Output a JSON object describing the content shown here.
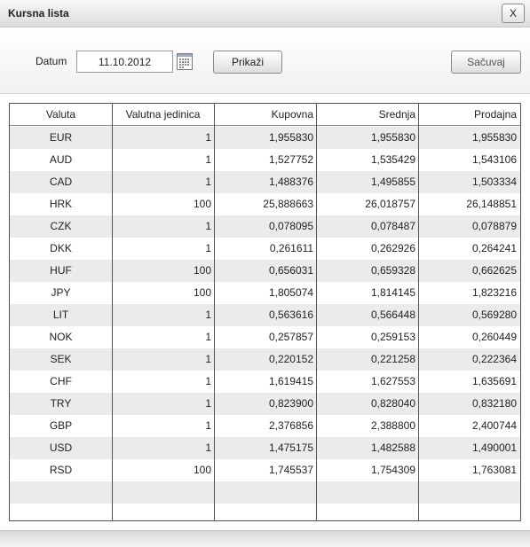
{
  "window": {
    "title": "Kursna lista",
    "close_label": "X"
  },
  "toolbar": {
    "date_label": "Datum",
    "date_value": "11.10.2012",
    "show_label": "Prikaži",
    "save_label": "Sačuvaj"
  },
  "table": {
    "columns": [
      "Valuta",
      "Valutna jedinica",
      "Kupovna",
      "Srednja",
      "Prodajna"
    ],
    "rows": [
      [
        "EUR",
        "1",
        "1,955830",
        "1,955830",
        "1,955830"
      ],
      [
        "AUD",
        "1",
        "1,527752",
        "1,535429",
        "1,543106"
      ],
      [
        "CAD",
        "1",
        "1,488376",
        "1,495855",
        "1,503334"
      ],
      [
        "HRK",
        "100",
        "25,888663",
        "26,018757",
        "26,148851"
      ],
      [
        "CZK",
        "1",
        "0,078095",
        "0,078487",
        "0,078879"
      ],
      [
        "DKK",
        "1",
        "0,261611",
        "0,262926",
        "0,264241"
      ],
      [
        "HUF",
        "100",
        "0,656031",
        "0,659328",
        "0,662625"
      ],
      [
        "JPY",
        "100",
        "1,805074",
        "1,814145",
        "1,823216"
      ],
      [
        "LIT",
        "1",
        "0,563616",
        "0,566448",
        "0,569280"
      ],
      [
        "NOK",
        "1",
        "0,257857",
        "0,259153",
        "0,260449"
      ],
      [
        "SEK",
        "1",
        "0,220152",
        "0,221258",
        "0,222364"
      ],
      [
        "CHF",
        "1",
        "1,619415",
        "1,627553",
        "1,635691"
      ],
      [
        "TRY",
        "1",
        "0,823900",
        "0,828040",
        "0,832180"
      ],
      [
        "GBP",
        "1",
        "2,376856",
        "2,388800",
        "2,400744"
      ],
      [
        "USD",
        "1",
        "1,475175",
        "1,482588",
        "1,490001"
      ],
      [
        "RSD",
        "100",
        "1,745537",
        "1,754309",
        "1,763081"
      ]
    ]
  },
  "icons": {
    "calendar": "calendar-icon"
  },
  "colors": {
    "alt_row": "#ebebeb",
    "grid_border": "#555555"
  }
}
